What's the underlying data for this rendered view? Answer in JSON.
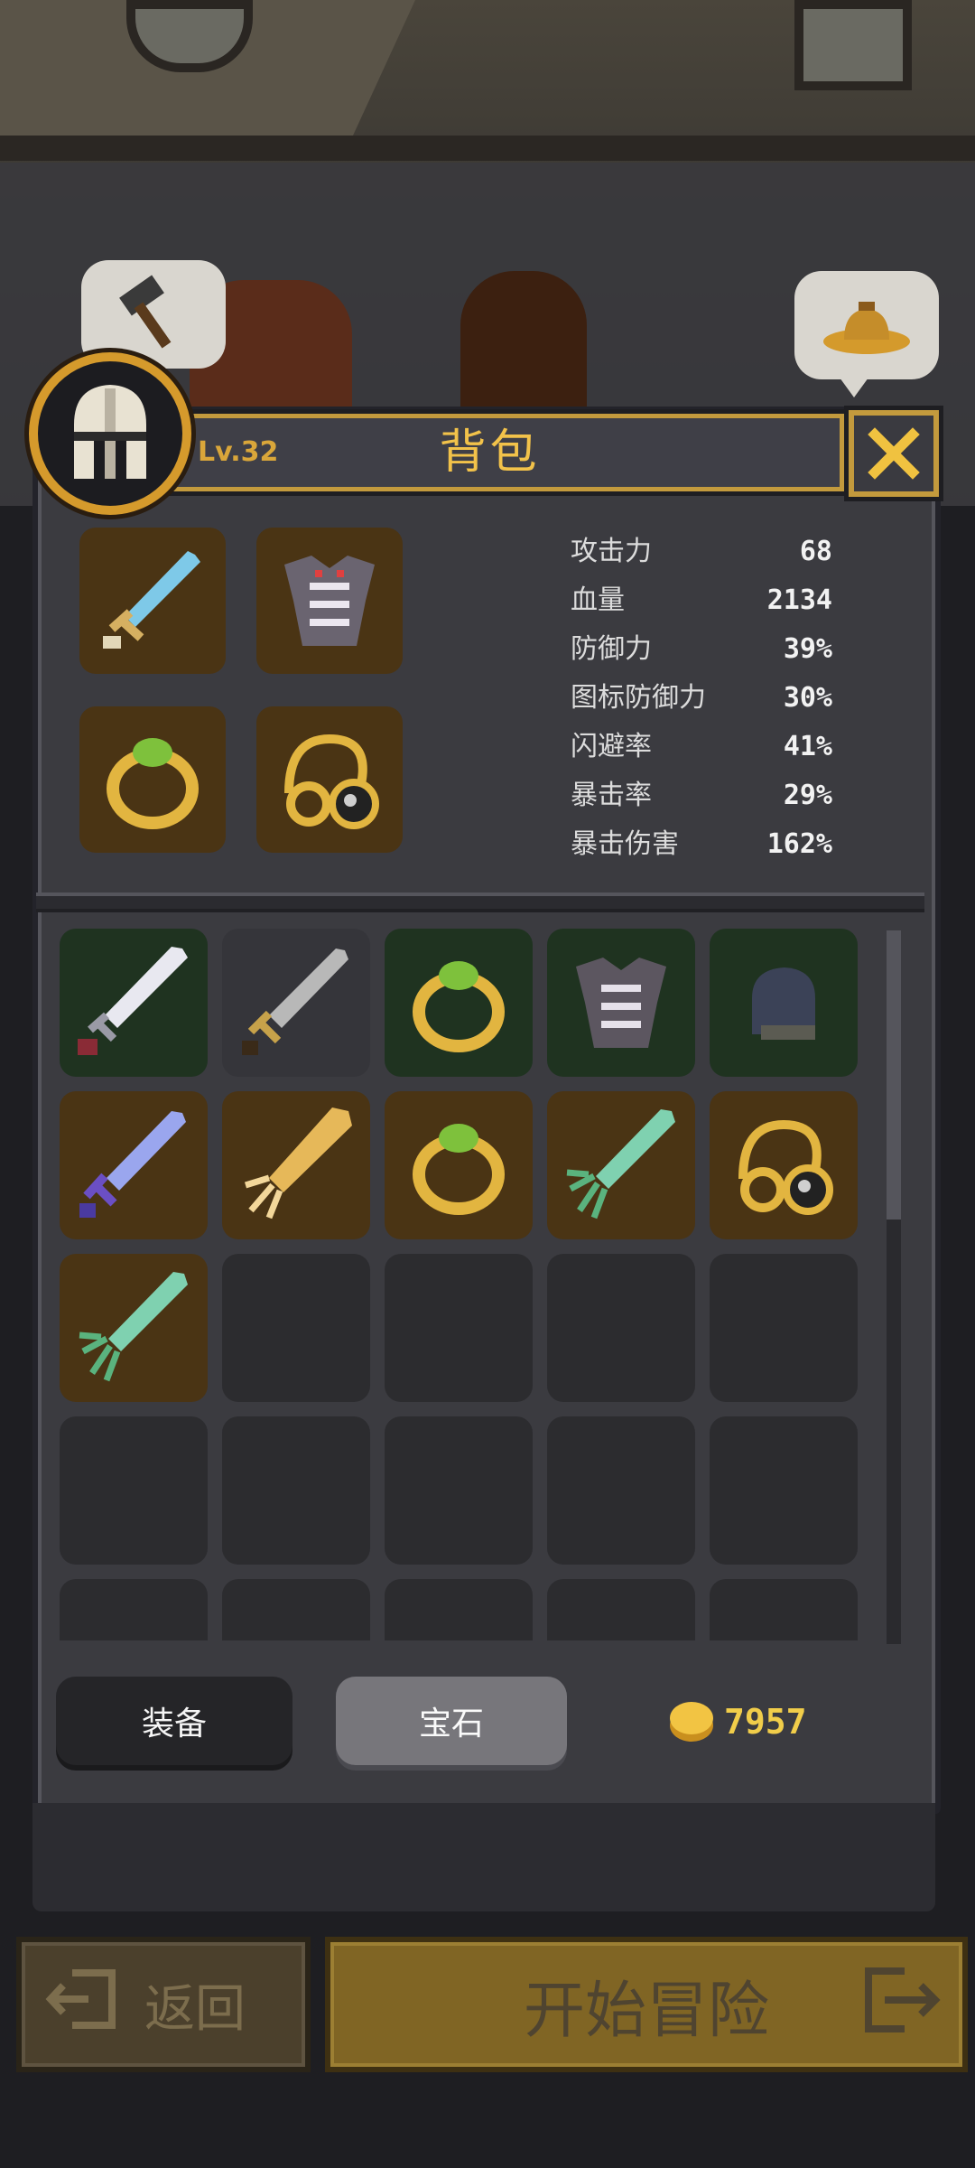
{
  "header": {
    "title": "背包",
    "level": "Lv.32"
  },
  "stats": [
    {
      "label": "攻击力",
      "value": "68"
    },
    {
      "label": "血量",
      "value": "2134"
    },
    {
      "label": "防御力",
      "value": "39%"
    },
    {
      "label": "图标防御力",
      "value": "30%"
    },
    {
      "label": "闪避率",
      "value": "41%"
    },
    {
      "label": "暴击率",
      "value": "29%"
    },
    {
      "label": "暴击伤害",
      "value": "162%"
    }
  ],
  "equipped": [
    {
      "icon": "crystal-sword-icon"
    },
    {
      "icon": "bone-armor-icon"
    },
    {
      "icon": "emerald-ring-icon"
    },
    {
      "icon": "gold-amulet-icon"
    }
  ],
  "inventory": [
    {
      "icon": "white-sword-icon",
      "rarity": "green"
    },
    {
      "icon": "steel-sword-icon",
      "rarity": "gray"
    },
    {
      "icon": "emerald-ring-icon",
      "rarity": "green"
    },
    {
      "icon": "bone-armor-icon",
      "rarity": "green"
    },
    {
      "icon": "dark-helmet-icon",
      "rarity": "green"
    },
    {
      "icon": "violet-sword-icon",
      "rarity": "brown"
    },
    {
      "icon": "golden-sword-icon",
      "rarity": "brown"
    },
    {
      "icon": "emerald-ring-icon",
      "rarity": "brown"
    },
    {
      "icon": "jade-sword-icon",
      "rarity": "brown"
    },
    {
      "icon": "gold-amulet-icon",
      "rarity": "brown"
    },
    {
      "icon": "jade-sword-icon",
      "rarity": "brown"
    }
  ],
  "tabs": {
    "equip": "装备",
    "gem": "宝石"
  },
  "gold": "7957",
  "footer": {
    "back": "返回",
    "start": "开始冒险"
  },
  "colors": {
    "accent_gold": "#c39a3d",
    "title_text": "#f2c24a",
    "rarity_green": "#1f3320",
    "rarity_brown": "#4a3414"
  }
}
